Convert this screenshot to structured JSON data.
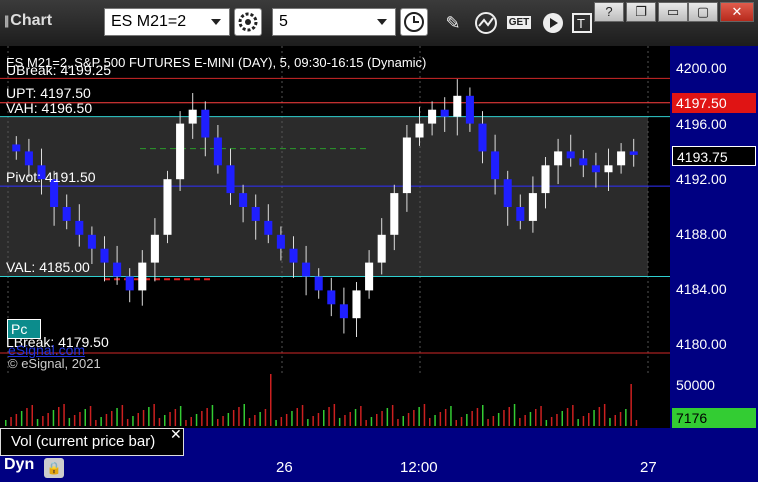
{
  "toolbar": {
    "app_title": "Chart",
    "symbol": "ES M21=2",
    "interval": "5",
    "icons": [
      "settings-gear-icon",
      "clock-icon",
      "pencil-icon",
      "study-icon",
      "get-icon",
      "play-icon",
      "text-icon"
    ]
  },
  "window_buttons": [
    "?",
    "❐",
    "▭",
    "▢",
    "✕"
  ],
  "chart": {
    "title": "ES M21=2, S&P 500 FUTURES E-MINI (DAY), 5, 09:30-16:15 (Dynamic)",
    "levels": {
      "ubreak": "UBreak: 4199.25",
      "upt": "UPT: 4197.50",
      "vah": "VAH: 4196.50",
      "pivot": "Pivot: 4191.50",
      "val": "VAL: 4185.00",
      "lbreak": "LBreak: 4179.50"
    },
    "last_price": "4193.75",
    "upt_badge": "4197.50",
    "price_ticks": [
      "4200.00",
      "4196.00",
      "4192.00",
      "4188.00",
      "4184.00",
      "4180.00"
    ],
    "copyright": "© eSignal, 2021",
    "link": "eSignal.com",
    "pc_button": "Pc",
    "colors": {
      "up_bar": "#ffffff",
      "down_bar": "#1f1fff",
      "value_area": "#2b2b2b",
      "axis": "#000082"
    }
  },
  "volume": {
    "label": "Vol (current price bar)",
    "close_glyph": "✕",
    "scale": "50000",
    "current": "7176",
    "current_color": "#33cc33"
  },
  "time_axis": {
    "ticks": [
      "26",
      "12:00",
      "27"
    ],
    "mode": "Dyn"
  },
  "chart_data": {
    "type": "candlestick",
    "title": "ES M21=2, S&P 500 FUTURES E-MINI (DAY), 5, 09:30-16:15 (Dynamic)",
    "ylim": [
      4178.5,
      4202.0
    ],
    "x_ticks": [
      "26",
      "12:00",
      "27"
    ],
    "closes": [
      4194,
      4193,
      4192,
      4190,
      4189,
      4188,
      4187,
      4186,
      4185,
      4184,
      4186,
      4188,
      4192,
      4196,
      4197,
      4195,
      4193,
      4191,
      4190,
      4189,
      4188,
      4187,
      4186,
      4185,
      4184,
      4183,
      4182,
      4184,
      4186,
      4188,
      4191,
      4195,
      4196,
      4197,
      4196.5,
      4198,
      4196,
      4194,
      4192,
      4190,
      4189,
      4191,
      4193,
      4194,
      4193.5,
      4193,
      4192.5,
      4193,
      4194,
      4193.75
    ],
    "levels": [
      {
        "name": "UBreak",
        "value": 4199.25
      },
      {
        "name": "UPT",
        "value": 4197.5
      },
      {
        "name": "VAH",
        "value": 4196.5
      },
      {
        "name": "Pivot",
        "value": 4191.5
      },
      {
        "name": "VAL",
        "value": 4185.0
      },
      {
        "name": "LBreak",
        "value": 4179.5
      }
    ]
  }
}
